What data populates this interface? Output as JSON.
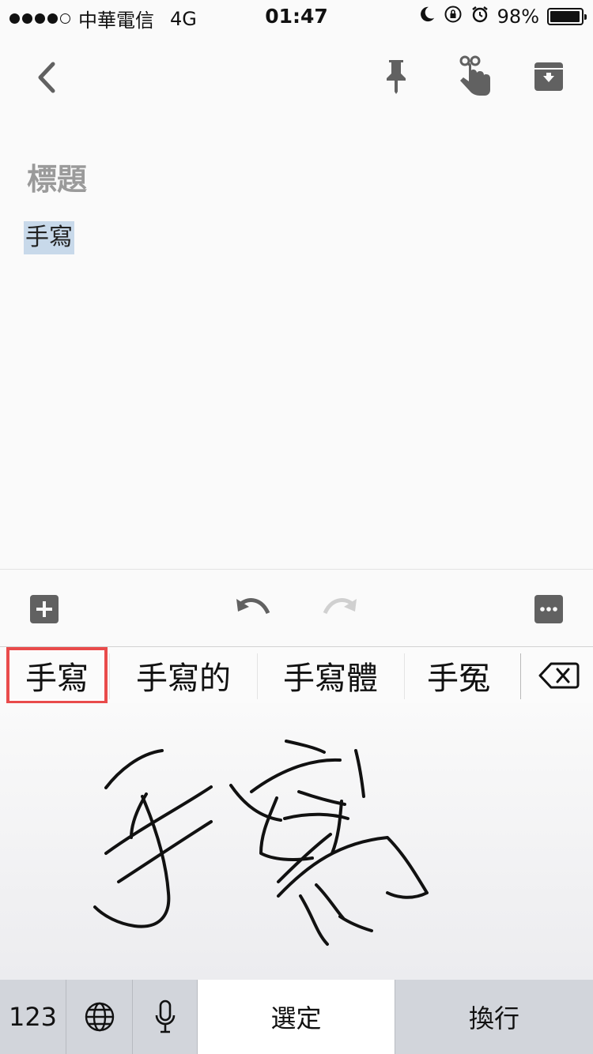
{
  "status_bar": {
    "carrier": "中華電信",
    "network": "4G",
    "time": "01:47",
    "battery_percent": "98%",
    "battery_level": 0.98,
    "icons": [
      "moon-icon",
      "rotation-lock-icon",
      "alarm-icon",
      "battery-icon"
    ]
  },
  "toolbar": {
    "back_icon": "chevron-left-icon",
    "pin_icon": "pin-icon",
    "reminder_icon": "finger-reminder-icon",
    "archive_icon": "archive-icon"
  },
  "note": {
    "title_placeholder": "標題",
    "body_text": "手寫"
  },
  "editor_bar": {
    "add_icon": "plus-box-icon",
    "undo_icon": "undo-icon",
    "redo_icon": "redo-icon",
    "more_icon": "more-dots-icon"
  },
  "candidates": [
    "手寫",
    "手寫的",
    "手寫體",
    "手冤"
  ],
  "keyboard": {
    "numbers_label": "123",
    "confirm_label": "選定",
    "newline_label": "換行"
  },
  "colors": {
    "highlight_border": "#e94b4b",
    "selection": "#c8d9ea",
    "icon_gray": "#616161"
  }
}
